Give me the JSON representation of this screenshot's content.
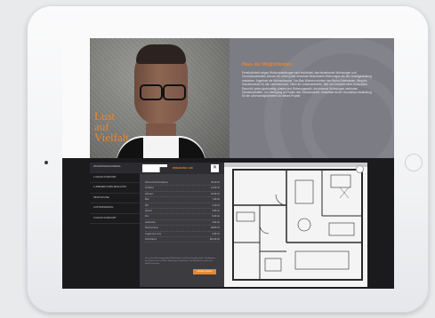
{
  "device": {
    "camera_icon": "camera-dot",
    "home_button_icon": "home-button"
  },
  "hero": {
    "slogan_lines": [
      "Lust",
      "auf",
      "Vielfalt"
    ],
    "text_title": "Haus der Möglichkeiten",
    "text_body": "Persönlichkeit zeigen Wohnvorstellungen sind individuell, das bestehende Wohnungen und Grundrissvarianten können Ihr Leben jeder einzelnen Bewohnerin Wohnungen bis der Grundgestaltung entstehen. Angebote die Wohnwünsche. Von Bau Wohnen erleben den Wohn-Erlebnissen, Weg bis Gemeinschaft, für alle Lebensformen. Offen für Lebensentwürfe. Wer die Entwürfe einer Konzeption Raum für jeden gleichzeitig, planen und Wohnungswahl, die bewusst Wohnungen verbinden Gemeinschaften. Zur Verfügung zu Finden den Gemeinschaft. Gestaltbar ist der Grundrisse darstellung für die Lebensmöglichkeiten für dieses Projekt."
  },
  "sidebar": {
    "items": [
      {
        "label": "WOHNUNGSAUSWAHL",
        "active": true
      },
      {
        "label": "1 RAUM KOMFORT",
        "active": false
      },
      {
        "label": "2 ZIMMER FAMILIENGLÜCK",
        "active": false
      },
      {
        "label": "PENTHOUSE",
        "active": false
      },
      {
        "label": "LOFTWOHNUNG",
        "active": false
      },
      {
        "label": "3 RAUM KOMFORT",
        "active": false
      }
    ]
  },
  "apartment": {
    "name": "WOHNUNG 4.06",
    "close_label": "✕",
    "rows": [
      {
        "label": "Wohnen/Kochen/Essen",
        "value": "33,10 m²"
      },
      {
        "label": "Schlafen",
        "value": "14,20 m²"
      },
      {
        "label": "Arbeiten",
        "value": "10,40 m²"
      },
      {
        "label": "Bad",
        "value": "7,20 m²"
      },
      {
        "label": "WC",
        "value": "2,10 m²"
      },
      {
        "label": "Abstell",
        "value": "2,80 m²"
      },
      {
        "label": "Flur",
        "value": "8,40 m²"
      },
      {
        "label": "Garderobe",
        "value": "3,20 m²"
      },
      {
        "label": "Dachterrasse",
        "value": "24,50 m²"
      },
      {
        "label": "Loggia (1/2 von)",
        "value": "4,30 m²"
      },
      {
        "label": "Wohnfläche",
        "value": "110,20 m²"
      }
    ],
    "note": "Die im Grundriss dargestellten Möblierungen sind Einrichtungsbeispiele. Die Angaben der Flächen sind ca.-Werte. Änderungen vorbehalten. Die Wohnfläche wurde nach WoFlV berechnet.",
    "cta_label": "Anfrage senden"
  },
  "plan": {
    "zoom_icon": "zoom-icon"
  },
  "colors": {
    "accent": "#e8862e",
    "panel": "#7b7c84",
    "dark": "#1b1b1d"
  }
}
